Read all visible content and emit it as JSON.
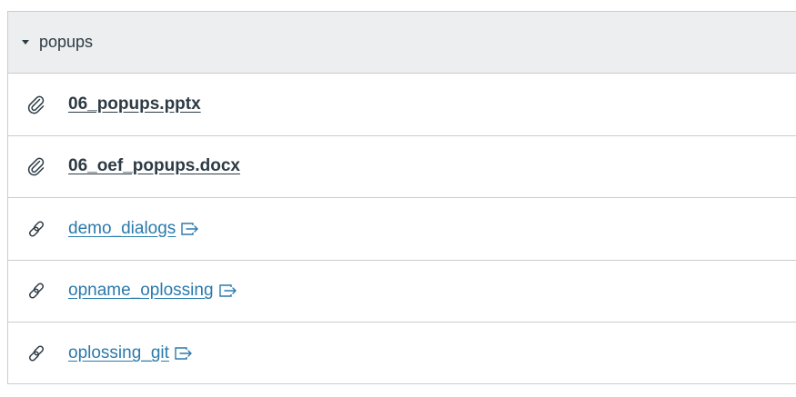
{
  "module": {
    "title": "popups",
    "caret_icon": "caret-down-icon",
    "items": [
      {
        "label": "06_popups.pptx",
        "type": "file",
        "icon": "paperclip-icon"
      },
      {
        "label": "06_oef_popups.docx",
        "type": "file",
        "icon": "paperclip-icon"
      },
      {
        "label": "demo_dialogs",
        "type": "external-link",
        "icon": "link-icon",
        "trailing_icon": "external-link-icon"
      },
      {
        "label": "opname_oplossing",
        "type": "external-link",
        "icon": "link-icon",
        "trailing_icon": "external-link-icon"
      },
      {
        "label": "oplossing_git",
        "type": "external-link",
        "icon": "link-icon",
        "trailing_icon": "external-link-icon"
      }
    ]
  },
  "colors": {
    "header_bg": "#eceeef",
    "text": "#2d3b45",
    "link": "#2a7aac",
    "border": "#c7cdd1"
  }
}
